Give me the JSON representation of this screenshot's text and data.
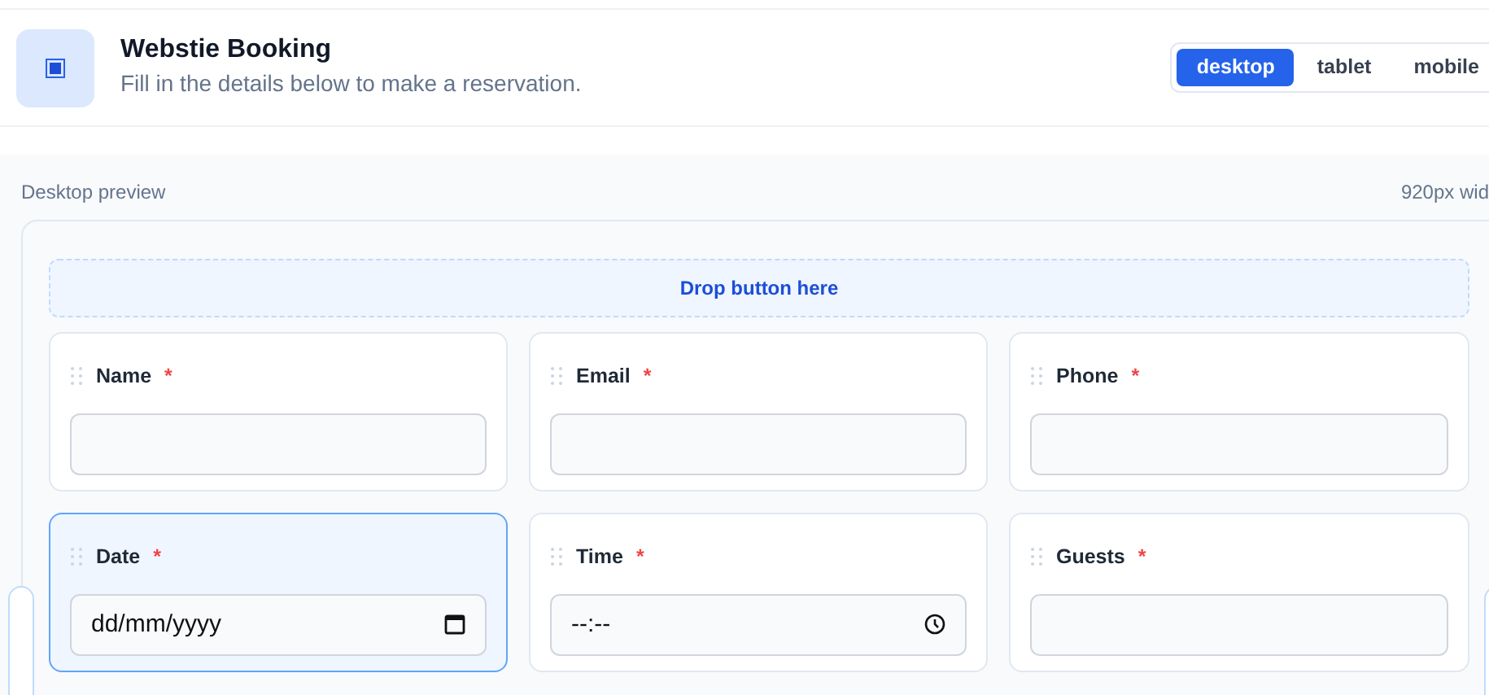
{
  "header": {
    "title": "Webstie Booking",
    "subtitle": "Fill in the details below to make a reservation."
  },
  "devices": [
    {
      "label": "desktop",
      "selected": true
    },
    {
      "label": "tablet",
      "selected": false
    },
    {
      "label": "mobile",
      "selected": false
    }
  ],
  "preview": {
    "label": "Desktop preview",
    "width_note": "920px wid"
  },
  "drop_zone": "Drop button here",
  "fields": [
    {
      "label": "Name",
      "required_mark": "*",
      "kind": "text",
      "selected": false
    },
    {
      "label": "Email",
      "required_mark": "*",
      "kind": "text",
      "selected": false
    },
    {
      "label": "Phone",
      "required_mark": "*",
      "kind": "text",
      "selected": false
    },
    {
      "label": "Date",
      "required_mark": "*",
      "kind": "date",
      "placeholder": "dd/mm/yyyy",
      "selected": true
    },
    {
      "label": "Time",
      "required_mark": "*",
      "kind": "time",
      "placeholder": "--:--",
      "selected": false
    },
    {
      "label": "Guests",
      "required_mark": "*",
      "kind": "text",
      "selected": false
    }
  ]
}
